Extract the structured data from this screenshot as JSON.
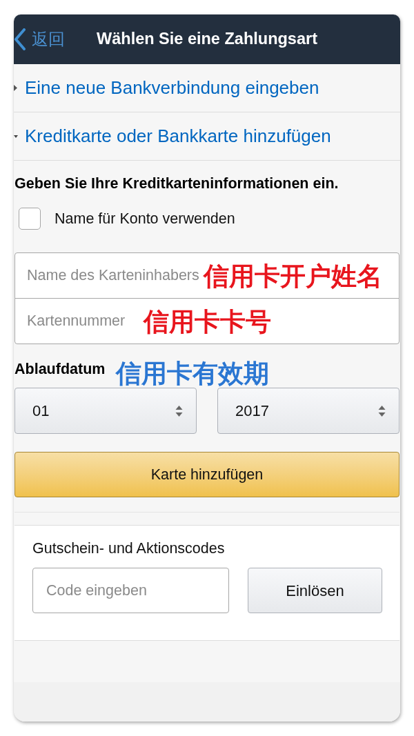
{
  "header": {
    "back_label": "返回",
    "title": "Wählen Sie eine Zahlungsart"
  },
  "sections": [
    {
      "label": "Eine neue Bankverbindung eingeben",
      "expanded": false
    },
    {
      "label": "Kreditkarte oder Bankkarte hinzufügen",
      "expanded": true
    }
  ],
  "card_form": {
    "heading": "Geben Sie Ihre Kreditkarteninformationen ein.",
    "checkbox": {
      "label": "Name für Konto verwenden",
      "checked": false
    },
    "fields": [
      {
        "placeholder": "Name des Karteninhabers",
        "annotation": {
          "text": "信用卡开户姓名",
          "color": "#e8151d"
        }
      },
      {
        "placeholder": "Kartennummer",
        "annotation": {
          "text": "信用卡卡号",
          "color": "#e8151d"
        }
      }
    ],
    "expiry": {
      "label": "Ablaufdatum",
      "annotation": {
        "text": "信用卡有效期",
        "color": "#2a76d2"
      },
      "selects": [
        {
          "value": "01"
        },
        {
          "value": "2017"
        }
      ]
    },
    "submit_button": "Karte hinzufügen"
  },
  "promo": {
    "heading": "Gutschein- und Aktionscodes",
    "placeholder": "Code eingeben",
    "button": "Einlösen"
  }
}
